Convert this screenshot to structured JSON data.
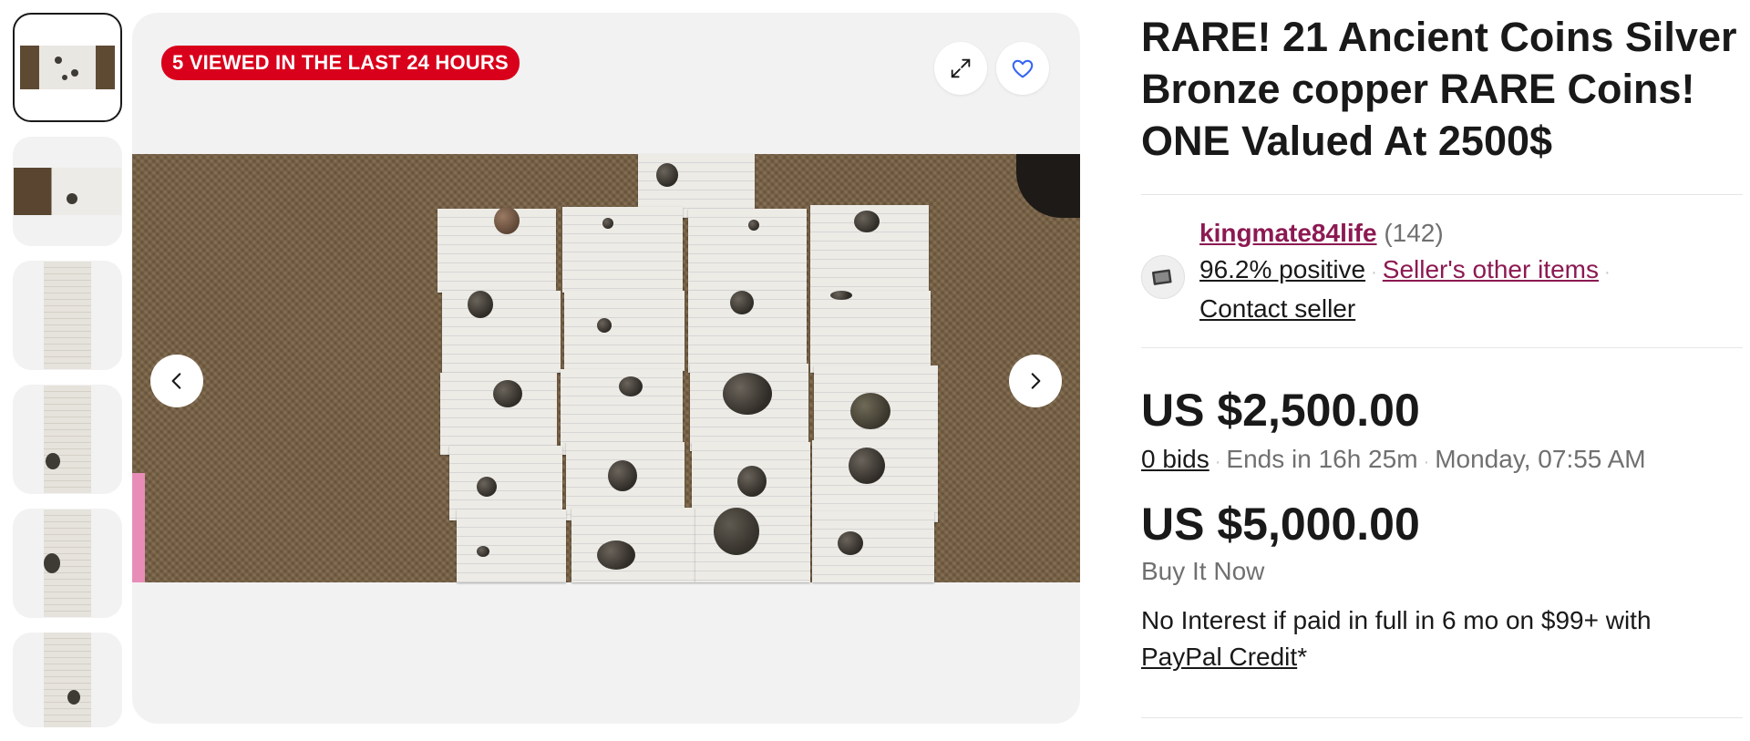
{
  "thumbnails": [
    {
      "id": 1,
      "active": true
    },
    {
      "id": 2,
      "active": false
    },
    {
      "id": 3,
      "active": false
    },
    {
      "id": 4,
      "active": false
    },
    {
      "id": 5,
      "active": false
    },
    {
      "id": 6,
      "active": false
    }
  ],
  "gallery": {
    "badge": "5 VIEWED IN THE LAST 24 HOURS",
    "expand_icon": "expand-icon",
    "favorite_icon": "heart-icon",
    "prev_icon": "chevron-left-icon",
    "next_icon": "chevron-right-icon"
  },
  "listing": {
    "title": "RARE! 21 Ancient Coins Silver Bronze copper RARE Coins! ONE Valued At 2500$"
  },
  "seller": {
    "name": "kingmate84life",
    "feedback_count": "(142)",
    "positive": "96.2% positive",
    "other_items": "Seller's other items",
    "contact": "Contact seller"
  },
  "auction": {
    "price": "US $2,500.00",
    "bids": "0 bids",
    "ends_in": "Ends in 16h 25m",
    "end_time": "Monday, 07:55 AM"
  },
  "buy_now": {
    "price": "US $5,000.00",
    "label": "Buy It Now",
    "financing_text": "No Interest if paid in full in 6 mo on $99+ with",
    "financing_link": "PayPal Credit",
    "financing_suffix": "*"
  },
  "colors": {
    "badge_bg": "#d9001b",
    "seller_link": "#8c1952",
    "text": "#191919",
    "muted": "#707070"
  }
}
